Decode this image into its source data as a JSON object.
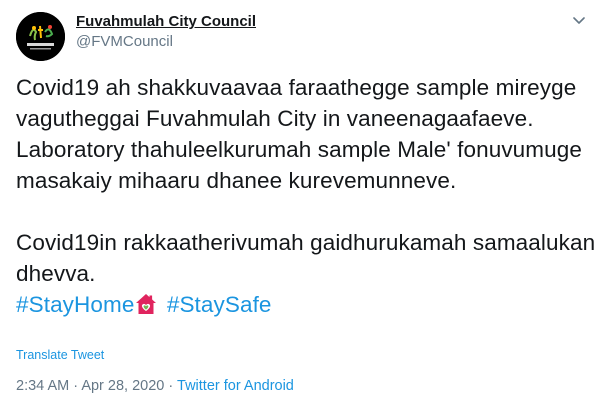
{
  "account": {
    "name": "Fuvahmulah City Council",
    "handle": "@FVMCouncil",
    "avatar_text": "FUVAHMULAH"
  },
  "tweet": {
    "paragraph1": "Covid19 ah shakkuvaavaa faraathegge sample mireyge vagutheggai Fuvahmulah City in vaneenagaafaeve. Laboratory thahuleelkurumah sample Male' fonuvumuge masakaiy mihaaru dhanee kurevemunneve.",
    "paragraph2": "Covid19in rakkaatherivumah gaidhurukamah samaalukan dhevva.",
    "hashtag1": "#StayHome",
    "hashtag2": "#StaySafe",
    "emoji": "house-with-heart"
  },
  "translate_label": "Translate Tweet",
  "meta": {
    "time": "2:34 AM",
    "separator": "·",
    "date": "Apr 28, 2020",
    "source": "Twitter for Android"
  },
  "colors": {
    "text": "#14171a",
    "secondary": "#657786",
    "link": "#1b95e0",
    "emoji_house": "#e0245e"
  }
}
